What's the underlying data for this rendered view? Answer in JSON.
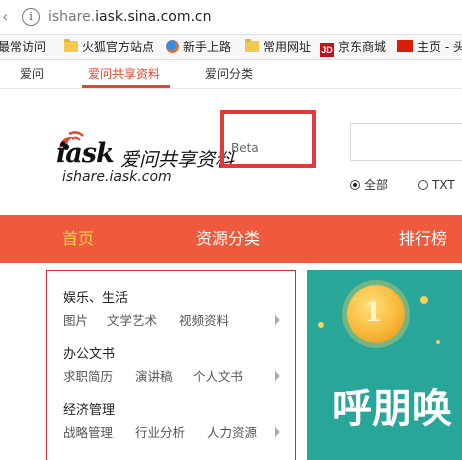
{
  "browser": {
    "url_host_prefix": "ishare.",
    "url_host_main": "iask",
    "url_host_suffix": ".sina.com.cn",
    "bookmarks": [
      "最常访问",
      "火狐官方站点",
      "新手上路",
      "常用网址",
      "京东商城",
      "主页 - 头"
    ],
    "jd_icon_text": "JD"
  },
  "site_nav": {
    "tabs": [
      "爱问",
      "爱问共享资料",
      "爱问分类"
    ],
    "active_index": 1
  },
  "logo": {
    "brand": "iask",
    "name_cn": "爱问共享资料",
    "domain": "ishare.iask.com",
    "badge": "Beta"
  },
  "search": {
    "placeholder": "",
    "options": [
      "全部",
      "TXT"
    ],
    "selected": "全部"
  },
  "main_nav": {
    "items": [
      "首页",
      "资源分类",
      "排行榜"
    ],
    "active_index": 0
  },
  "categories": [
    {
      "title": "娱乐、生活",
      "links": [
        "图片",
        "文学艺术",
        "视频资料"
      ]
    },
    {
      "title": "办公文书",
      "links": [
        "求职简历",
        "演讲稿",
        "个人文书"
      ]
    },
    {
      "title": "经济管理",
      "links": [
        "战略管理",
        "行业分析",
        "人力资源"
      ]
    }
  ],
  "banner": {
    "coin_number": "1",
    "headline": "呼朋唤"
  },
  "colors": {
    "accent": "#f05a3c",
    "active_nav_text": "#ffd34a",
    "banner_bg": "#29a69a",
    "highlight_box": "#e03a3a"
  }
}
